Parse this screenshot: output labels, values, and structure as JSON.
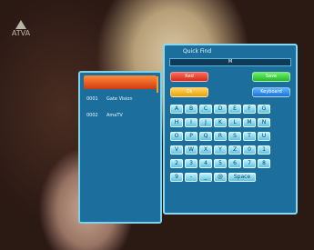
{
  "channel_logo": {
    "text": "ATVA",
    "icon": "broadcast-logo-icon"
  },
  "channel_list": [
    {
      "num": "",
      "name": "",
      "selected": true
    },
    {
      "num": "0001",
      "name": "Gate Vision",
      "selected": false
    },
    {
      "num": "0002",
      "name": "AmaTV",
      "selected": false
    }
  ],
  "quick_find": {
    "title": "Quick Find",
    "input_value": "M",
    "color_buttons": [
      {
        "name": "red",
        "label": "Red"
      },
      {
        "name": "green",
        "label": "Save"
      },
      {
        "name": "yellow",
        "label": "Ok"
      },
      {
        "name": "blue",
        "label": "Keyboard"
      }
    ],
    "keys": [
      [
        "A",
        "B",
        "C",
        "D",
        "E",
        "F",
        "G"
      ],
      [
        "H",
        "I",
        "J",
        "K",
        "L",
        "M",
        "N"
      ],
      [
        "O",
        "P",
        "Q",
        "R",
        "S",
        "T",
        "U"
      ],
      [
        "V",
        "W",
        "X",
        "Y",
        "Z",
        "0",
        "1"
      ],
      [
        "2",
        "3",
        "4",
        "5",
        "6",
        "7",
        "8"
      ],
      [
        "9",
        "-",
        "_",
        "@",
        "Space"
      ]
    ]
  },
  "colors": {
    "panel": "#1c6f9c",
    "border": "#8ad8ee",
    "key": "#7fd3ea",
    "selection": "#e2501a"
  }
}
